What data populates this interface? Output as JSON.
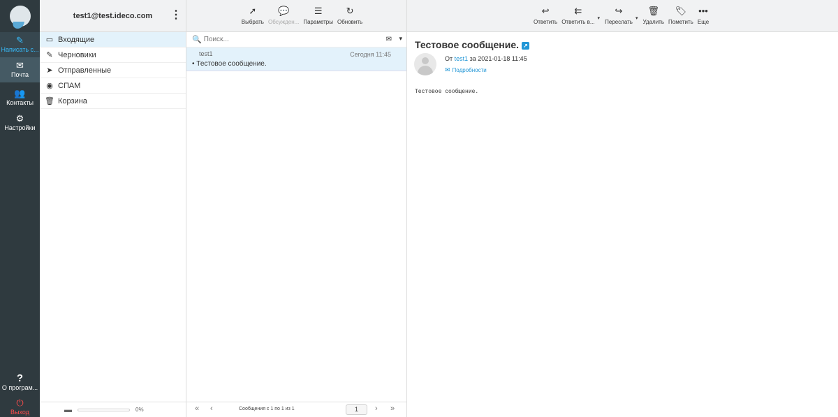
{
  "rail": {
    "compose": "Написать с...",
    "mail": "Почта",
    "contacts": "Контакты",
    "settings": "Настройки",
    "about": "О програм...",
    "logout": "Выход"
  },
  "account": "test1@test.ideco.com",
  "folders": [
    {
      "label": "Входящие",
      "icon": "inbox-icon",
      "glyph": "▭",
      "selected": true
    },
    {
      "label": "Черновики",
      "icon": "pencil-icon",
      "glyph": "✎",
      "selected": false
    },
    {
      "label": "Отправленные",
      "icon": "paper-plane-icon",
      "glyph": "➤",
      "selected": false
    },
    {
      "label": "СПАМ",
      "icon": "spam-icon",
      "glyph": "◉",
      "selected": false
    },
    {
      "label": "Корзина",
      "icon": "trash-icon",
      "glyph": "🗑",
      "selected": false
    }
  ],
  "quota": {
    "percent_label": "0%",
    "percent": 0
  },
  "list_toolbar": {
    "select": "Выбрать",
    "threads": "Обсужден...",
    "options": "Параметры",
    "refresh": "Обновить"
  },
  "search": {
    "placeholder": "Поиск..."
  },
  "messages": [
    {
      "from": "test1",
      "date": "Сегодня 11:45",
      "subject": "Тестовое сообщение."
    }
  ],
  "pagination": {
    "info": "Сообщения с 1 по 1 из 1",
    "page": "1"
  },
  "preview_toolbar": {
    "reply": "Ответить",
    "reply_all": "Ответить в...",
    "forward": "Переслать",
    "delete": "Удалить",
    "mark": "Пометить",
    "more": "Еще"
  },
  "preview": {
    "subject": "Тестовое сообщение.",
    "from_prefix": "От",
    "from": "test1",
    "date_text": "за 2021-01-18 11:45",
    "details": "Подробности",
    "body": "Тестовое сообщение."
  },
  "colors": {
    "accent": "#37beff",
    "rail": "#2f3a3f",
    "selected": "#e3f2fb",
    "logout": "#ff4c4c",
    "link": "#2196d6"
  }
}
